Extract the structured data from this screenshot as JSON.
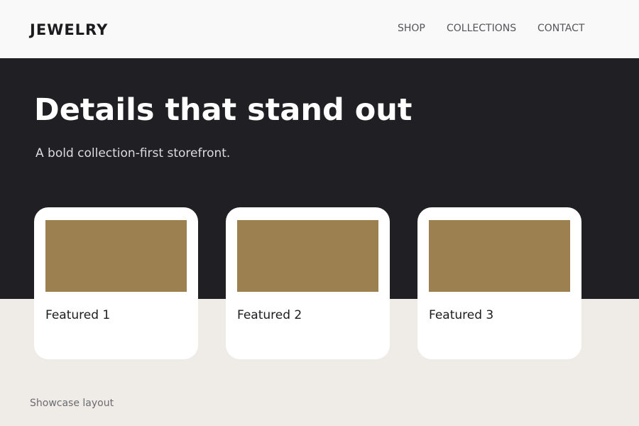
{
  "header": {
    "logo": "JEWELRY",
    "nav": [
      {
        "label": "SHOP"
      },
      {
        "label": "COLLECTIONS"
      },
      {
        "label": "CONTACT"
      }
    ]
  },
  "hero": {
    "title": "Details that stand out",
    "subtitle": "A bold collection-first storefront."
  },
  "cards": [
    {
      "title": "Featured 1",
      "image_color": "#9c8050"
    },
    {
      "title": "Featured 2",
      "image_color": "#9c8050"
    },
    {
      "title": "Featured 3",
      "image_color": "#9c8050"
    }
  ],
  "footer": {
    "text": "Showcase layout"
  },
  "colors": {
    "header_bg": "#f9f9f9",
    "hero_bg": "#201f23",
    "page_bg": "#efebe6",
    "accent": "#9c8050"
  }
}
